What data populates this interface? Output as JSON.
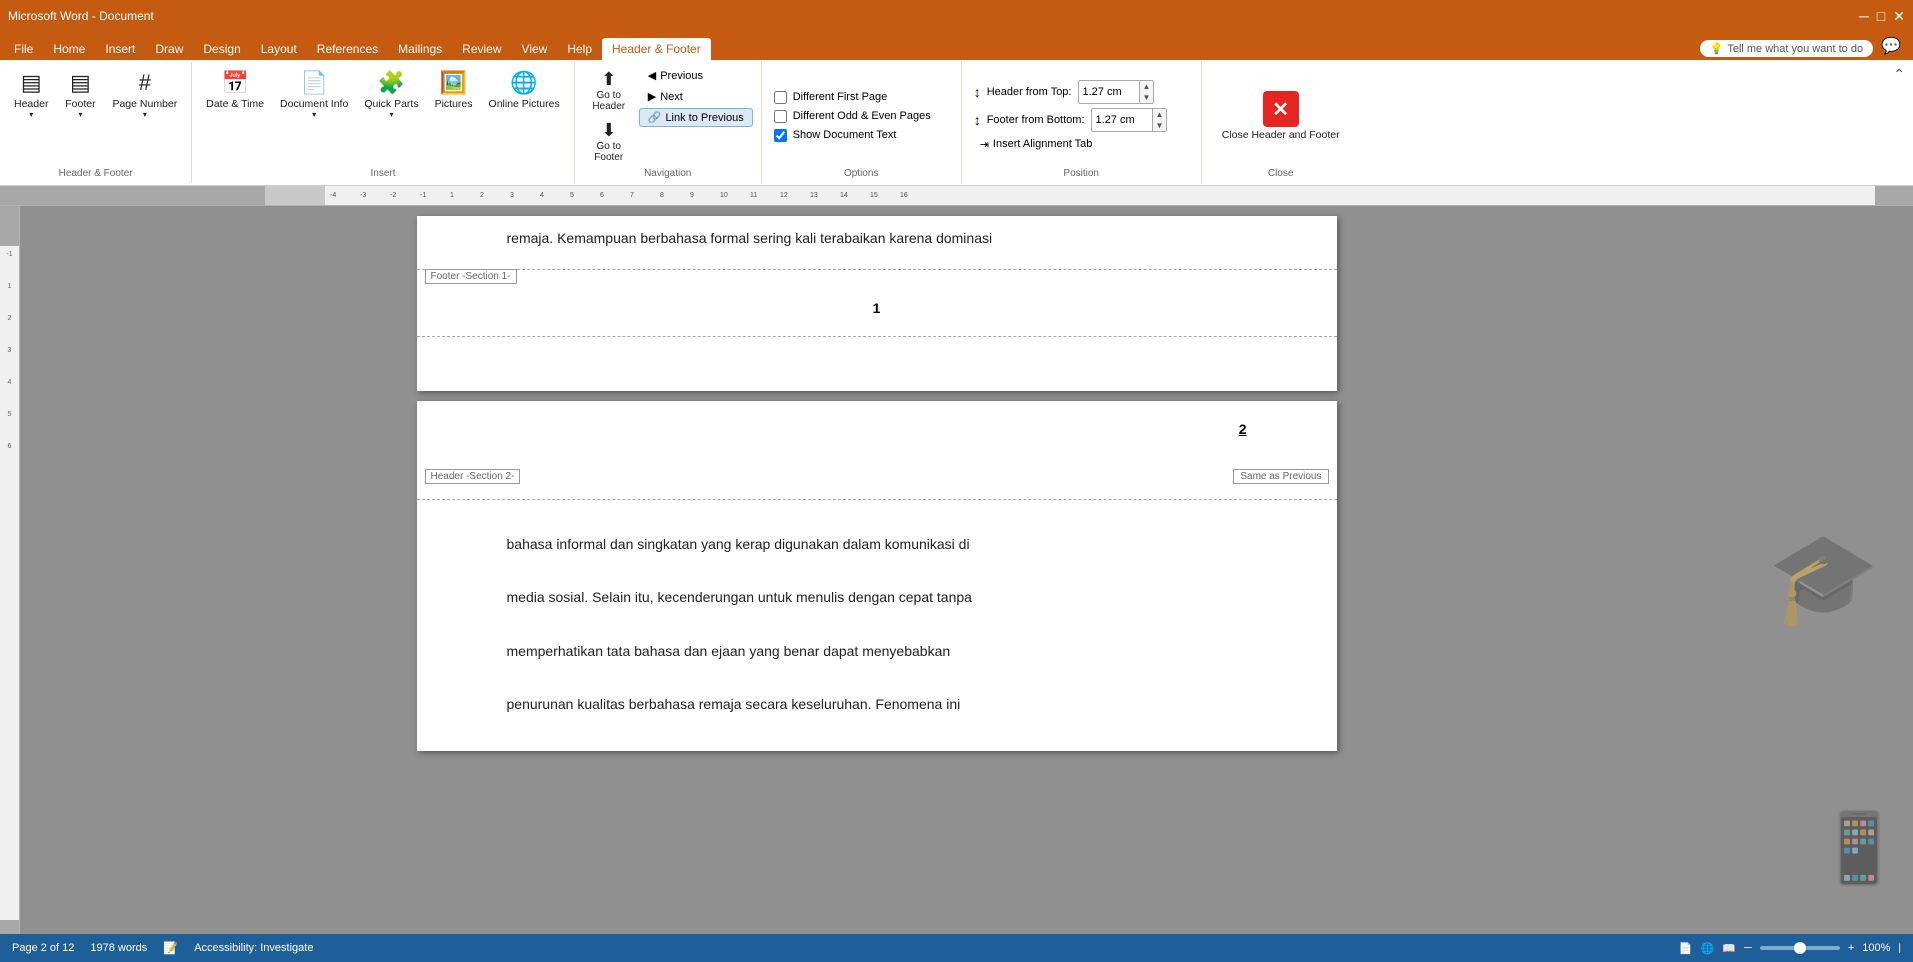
{
  "app": {
    "title": "Microsoft Word - Document"
  },
  "tabs": [
    {
      "label": "File",
      "active": false
    },
    {
      "label": "Home",
      "active": false
    },
    {
      "label": "Insert",
      "active": false
    },
    {
      "label": "Draw",
      "active": false
    },
    {
      "label": "Design",
      "active": false
    },
    {
      "label": "Layout",
      "active": false
    },
    {
      "label": "References",
      "active": false
    },
    {
      "label": "Mailings",
      "active": false
    },
    {
      "label": "Review",
      "active": false
    },
    {
      "label": "View",
      "active": false
    },
    {
      "label": "Help",
      "active": false
    },
    {
      "label": "Header & Footer",
      "active": true
    }
  ],
  "ribbon": {
    "groups": {
      "header_footer": {
        "label": "Header & Footer",
        "header_btn": "Header",
        "footer_btn": "Footer",
        "page_number_btn": "Page Number"
      },
      "insert": {
        "label": "Insert",
        "date_time_btn": "Date & Time",
        "document_info_btn": "Document Info",
        "quick_parts_btn": "Quick Parts",
        "pictures_btn": "Pictures",
        "online_pictures_btn": "Online Pictures"
      },
      "navigation": {
        "label": "Navigation",
        "go_to_header_btn": "Go to Header",
        "go_to_footer_btn": "Go to Footer",
        "previous_btn": "Previous",
        "next_btn": "Next",
        "link_to_previous_btn": "Link to Previous"
      },
      "options": {
        "label": "Options",
        "different_first_page": "Different First Page",
        "different_odd_even": "Different Odd & Even Pages",
        "show_document_text": "Show Document Text",
        "different_first_checked": false,
        "different_odd_even_checked": false,
        "show_document_text_checked": true
      },
      "position": {
        "label": "Position",
        "header_from_top_label": "Header from Top:",
        "header_from_top_value": "1.27 cm",
        "footer_from_bottom_label": "Footer from Bottom:",
        "footer_from_bottom_value": "1.27 cm",
        "insert_alignment_tab_btn": "Insert Alignment Tab"
      },
      "close": {
        "label": "Close",
        "close_btn": "Close Header and Footer"
      }
    }
  },
  "document": {
    "page1": {
      "body_text": "remaja. Kemampuan berbahasa formal sering kali terabaikan karena dominasi",
      "footer_label": "Footer -Section 1-",
      "footer_page_number": "1"
    },
    "page2": {
      "header_label": "Header -Section 2-",
      "page_number": "2",
      "same_as_previous": "Same as Previous",
      "body_line1": "bahasa informal dan singkatan yang kerap digunakan dalam komunikasi di",
      "body_line2": "media sosial. Selain itu, kecenderungan untuk menulis dengan cepat tanpa",
      "body_line3": "memperhatikan tata bahasa dan ejaan yang benar dapat menyebabkan",
      "body_line4": "penurunan kualitas berbahasa remaja secara keseluruhan. Fenomena ini"
    }
  },
  "status_bar": {
    "page_info": "Page 2 of 12",
    "words": "1978 words",
    "accessibility": "Accessibility: Investigate",
    "zoom": "100%"
  },
  "tell_me": "Tell me what you want to do"
}
